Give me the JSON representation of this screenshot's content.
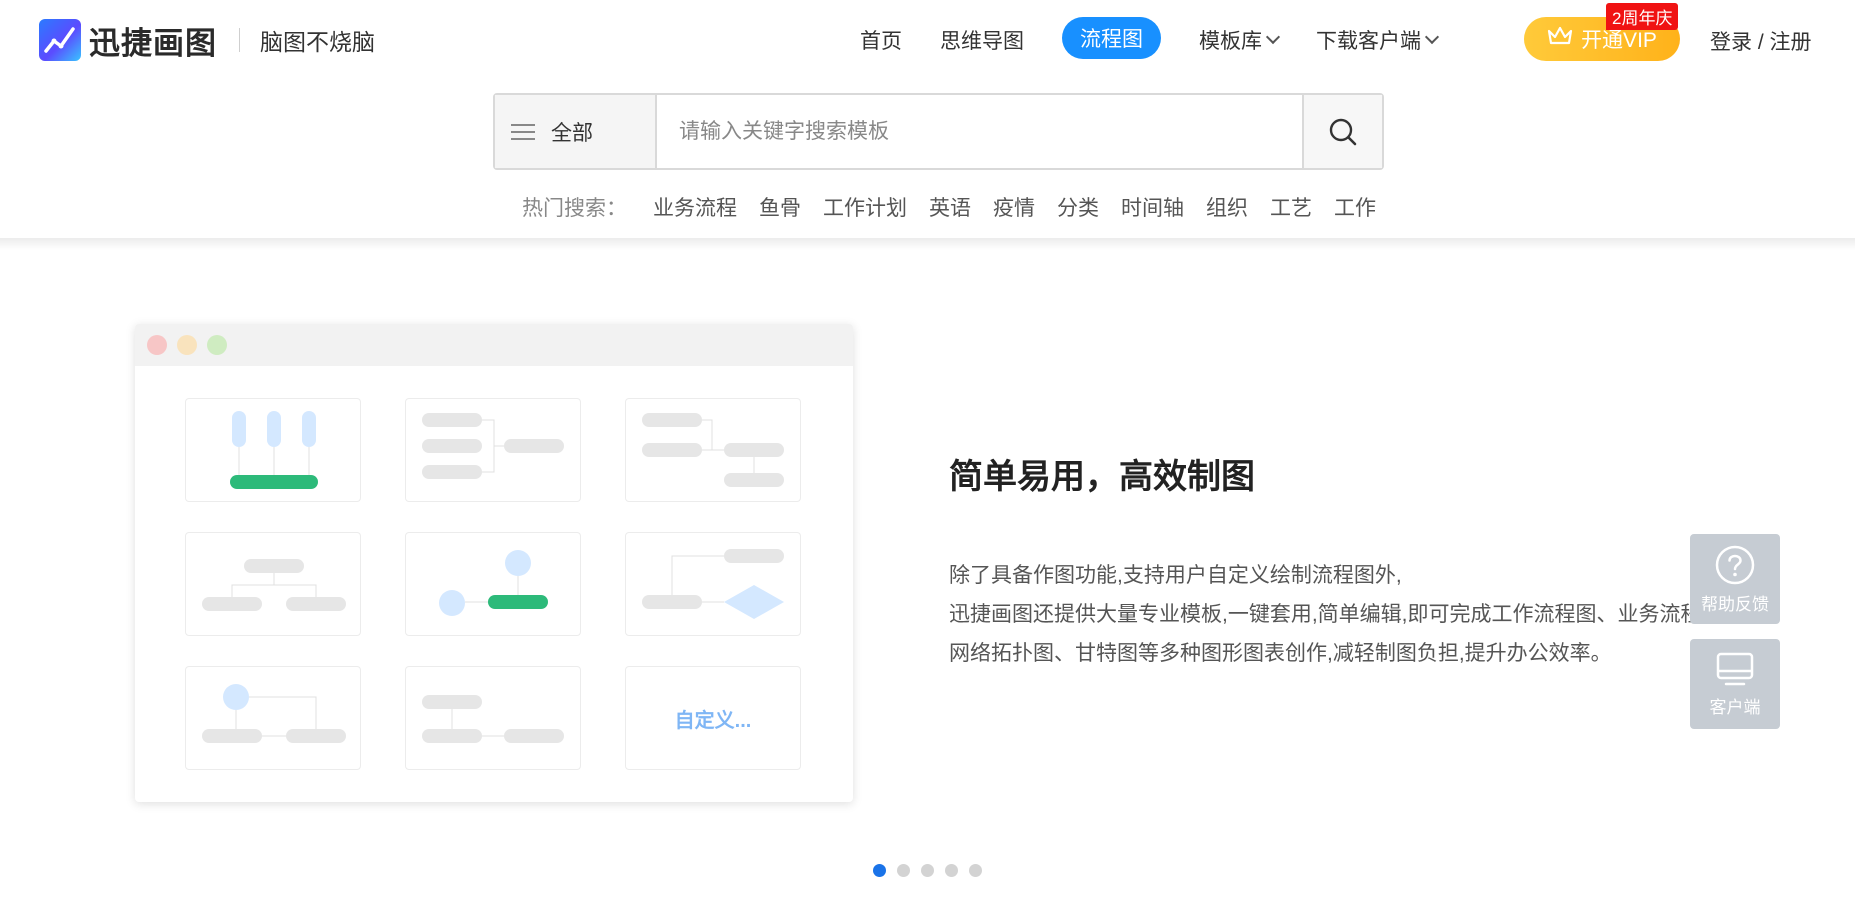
{
  "brand": {
    "name": "迅捷画图",
    "slogan": "脑图不烧脑"
  },
  "nav": {
    "items": [
      {
        "label": "首页",
        "active": false,
        "dropdown": false
      },
      {
        "label": "思维导图",
        "active": false,
        "dropdown": false
      },
      {
        "label": "流程图",
        "active": true,
        "dropdown": false
      },
      {
        "label": "模板库",
        "active": false,
        "dropdown": true
      },
      {
        "label": "下载客户端",
        "active": false,
        "dropdown": true
      }
    ],
    "vip_label": "开通VIP",
    "vip_badge": "2周年庆",
    "login_label": "登录 / 注册"
  },
  "search": {
    "category": "全部",
    "placeholder": "请输入关键字搜索模板",
    "value": "",
    "hot_label": "热门搜索：",
    "hot_items": [
      "业务流程",
      "鱼骨",
      "工作计划",
      "英语",
      "疫情",
      "分类",
      "时间轴",
      "组织",
      "工艺",
      "工作"
    ]
  },
  "banner": {
    "title": "简单易用，高效制图",
    "desc_lines": [
      "除了具备作图功能,支持用户自定义绘制流程图外,",
      "迅捷画图还提供大量专业模板,一键套用,简单编辑,即可完成工作流程图、业务流程图、",
      "网络拓扑图、甘特图等多种图形图表创作,减轻制图负担,提升办公效率。"
    ],
    "custom_card_label": "自定义...",
    "window_dot_colors": [
      "#f7c6c6",
      "#f9e3bd",
      "#cfecc1"
    ],
    "accent_green": "#2dba7a",
    "accent_blue_light": "#d4e8ff",
    "slide_count": 5,
    "active_slide": 1
  },
  "float": {
    "help_label": "帮助反馈",
    "client_label": "客户端"
  },
  "colors": {
    "primary": "#1890ff",
    "vip": "#ffb21a",
    "badge": "#f01313"
  }
}
